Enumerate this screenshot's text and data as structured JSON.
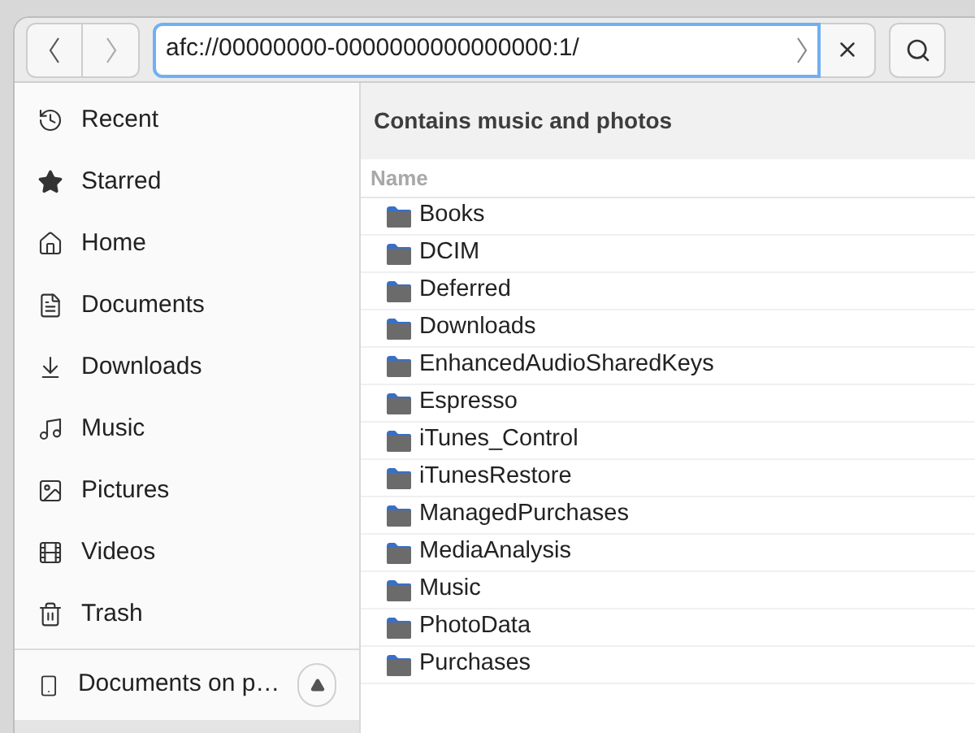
{
  "header": {
    "location": "afc://00000000-0000000000000000:1/"
  },
  "sidebar": {
    "items": [
      {
        "kind": "recent",
        "label": "Recent",
        "selected": false
      },
      {
        "kind": "starred",
        "label": "Starred",
        "selected": false
      },
      {
        "kind": "home",
        "label": "Home",
        "selected": false
      },
      {
        "kind": "documents",
        "label": "Documents",
        "selected": false
      },
      {
        "kind": "downloads",
        "label": "Downloads",
        "selected": false
      },
      {
        "kind": "music",
        "label": "Music",
        "selected": false
      },
      {
        "kind": "pictures",
        "label": "Pictures",
        "selected": false
      },
      {
        "kind": "videos",
        "label": "Videos",
        "selected": false
      },
      {
        "kind": "trash",
        "label": "Trash",
        "selected": false
      }
    ],
    "devices": [
      {
        "label": "Documents on p…",
        "selected": false
      }
    ]
  },
  "content": {
    "title": "Contains music and photos",
    "columns": [
      "Name"
    ],
    "rows": [
      {
        "name": "Books"
      },
      {
        "name": "DCIM"
      },
      {
        "name": "Deferred"
      },
      {
        "name": "Downloads"
      },
      {
        "name": "EnhancedAudioSharedKeys"
      },
      {
        "name": "Espresso"
      },
      {
        "name": "iTunes_Control"
      },
      {
        "name": "iTunesRestore"
      },
      {
        "name": "ManagedPurchases"
      },
      {
        "name": "MediaAnalysis"
      },
      {
        "name": "Music"
      },
      {
        "name": "PhotoData"
      },
      {
        "name": "Purchases"
      }
    ]
  }
}
